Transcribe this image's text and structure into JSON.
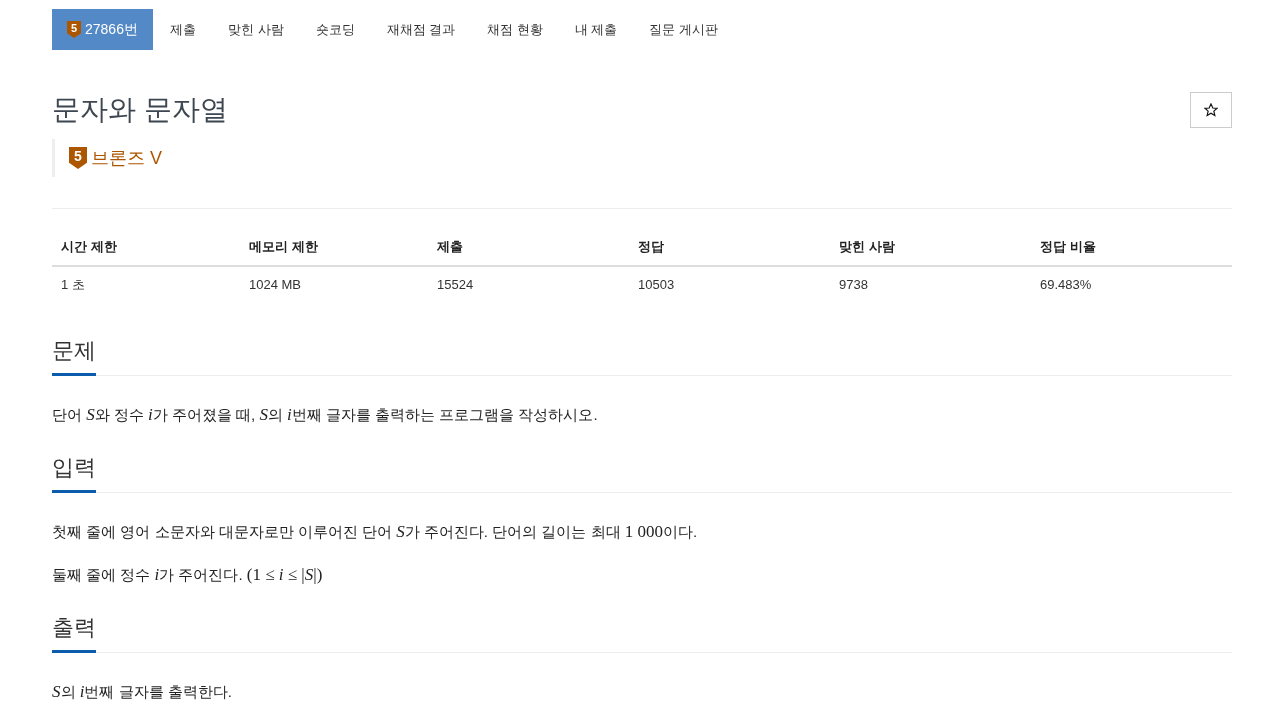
{
  "nav_tabs": [
    {
      "label": "27866번",
      "badge": "5",
      "selected": true
    },
    {
      "label": "제출",
      "selected": false
    },
    {
      "label": "맞힌 사람",
      "selected": false
    },
    {
      "label": "숏코딩",
      "selected": false
    },
    {
      "label": "재채점 결과",
      "selected": false
    },
    {
      "label": "채점 현황",
      "selected": false
    },
    {
      "label": "내 제출",
      "selected": false
    },
    {
      "label": "질문 게시판",
      "selected": false
    }
  ],
  "problem": {
    "title": "문자와 문자열",
    "tier": {
      "badge": "5",
      "label": "브론즈 V"
    }
  },
  "info_table": {
    "columns": [
      "시간 제한",
      "메모리 제한",
      "제출",
      "정답",
      "맞힌 사람",
      "정답 비율"
    ],
    "rows": [
      [
        "1 초",
        "1024 MB",
        "15524",
        "10503",
        "9738",
        "69.483%"
      ]
    ]
  },
  "sections": [
    {
      "heading": "문제",
      "paragraphs": [
        [
          {
            "kind": "text",
            "text": "단어 "
          },
          {
            "kind": "variable",
            "text": "S"
          },
          {
            "kind": "text",
            "text": "와 정수 "
          },
          {
            "kind": "variable",
            "text": "i"
          },
          {
            "kind": "text",
            "text": "가 주어졌을 때, "
          },
          {
            "kind": "variable",
            "text": "S"
          },
          {
            "kind": "text",
            "text": "의 "
          },
          {
            "kind": "variable",
            "text": "i"
          },
          {
            "kind": "text",
            "text": "번째 글자를 출력하는 프로그램을 작성하시오."
          }
        ]
      ]
    },
    {
      "heading": "입력",
      "paragraphs": [
        [
          {
            "kind": "text",
            "text": "첫째 줄에 영어 소문자와 대문자로만 이루어진 단어 "
          },
          {
            "kind": "variable",
            "text": "S"
          },
          {
            "kind": "text",
            "text": "가 주어진다. 단어의 길이는 최대 "
          },
          {
            "kind": "formula",
            "text": "1 000"
          },
          {
            "kind": "text",
            "text": "이다."
          }
        ],
        [
          {
            "kind": "text",
            "text": "둘째 줄에 정수 "
          },
          {
            "kind": "variable",
            "text": "i"
          },
          {
            "kind": "text",
            "text": "가 주어진다. "
          },
          {
            "kind": "formula",
            "text": "(1 ≤ "
          },
          {
            "kind": "variable",
            "text": "i"
          },
          {
            "kind": "formula",
            "text": " ≤ |"
          },
          {
            "kind": "variable",
            "text": "S"
          },
          {
            "kind": "formula",
            "text": "|)"
          }
        ]
      ]
    },
    {
      "heading": "출력",
      "paragraphs": [
        [
          {
            "kind": "variable",
            "text": "S"
          },
          {
            "kind": "text",
            "text": "의 "
          },
          {
            "kind": "variable",
            "text": "i"
          },
          {
            "kind": "text",
            "text": "번째 글자를 출력한다."
          }
        ]
      ]
    }
  ]
}
